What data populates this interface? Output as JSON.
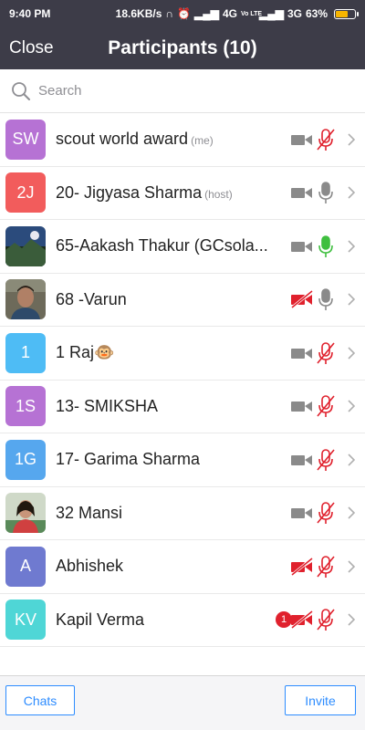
{
  "status": {
    "time": "9:40 PM",
    "net_speed": "18.6KB/s",
    "signal1": "4G",
    "volte": "Vo LTE",
    "signal2": "3G",
    "battery": "63%"
  },
  "header": {
    "close_label": "Close",
    "title": "Participants (10)"
  },
  "search": {
    "placeholder": "Search"
  },
  "participants": [
    {
      "initials": "SW",
      "name": "scout world award",
      "tag": "(me)",
      "avatar_color": "#b672d4",
      "video_muted": false,
      "audio_muted": true,
      "badge": ""
    },
    {
      "initials": "2J",
      "name": "20- Jigyasa Sharma",
      "tag": "(host)",
      "avatar_color": "#f25c5c",
      "video_muted": false,
      "audio_muted": false,
      "badge": ""
    },
    {
      "initials": "",
      "name": "65-Aakash Thakur (GCsola...",
      "tag": "",
      "avatar_color": "photo-landscape",
      "video_muted": false,
      "audio_muted": false,
      "audio_active": true,
      "badge": ""
    },
    {
      "initials": "",
      "name": "68 -Varun",
      "tag": "",
      "avatar_color": "photo-portrait",
      "video_muted": true,
      "audio_muted": false,
      "badge": ""
    },
    {
      "initials": "1",
      "name": "1 Raj🐵",
      "tag": "",
      "avatar_color": "#4ebcf5",
      "video_muted": false,
      "audio_muted": true,
      "badge": ""
    },
    {
      "initials": "1S",
      "name": "13- SMIKSHA",
      "tag": "",
      "avatar_color": "#b672d4",
      "video_muted": false,
      "audio_muted": true,
      "badge": ""
    },
    {
      "initials": "1G",
      "name": "17- Garima Sharma",
      "tag": "",
      "avatar_color": "#56a7ee",
      "video_muted": false,
      "audio_muted": true,
      "badge": ""
    },
    {
      "initials": "",
      "name": "32 Mansi",
      "tag": "",
      "avatar_color": "photo-girl",
      "video_muted": false,
      "audio_muted": true,
      "badge": ""
    },
    {
      "initials": "A",
      "name": "Abhishek",
      "tag": "",
      "avatar_color": "#6f7ad0",
      "video_muted": true,
      "audio_muted": true,
      "badge": ""
    },
    {
      "initials": "KV",
      "name": "Kapil Verma",
      "tag": "",
      "avatar_color": "#4fd6d6",
      "video_muted": true,
      "audio_muted": true,
      "badge": "1"
    }
  ],
  "footer": {
    "chats_label": "Chats",
    "invite_label": "Invite"
  }
}
